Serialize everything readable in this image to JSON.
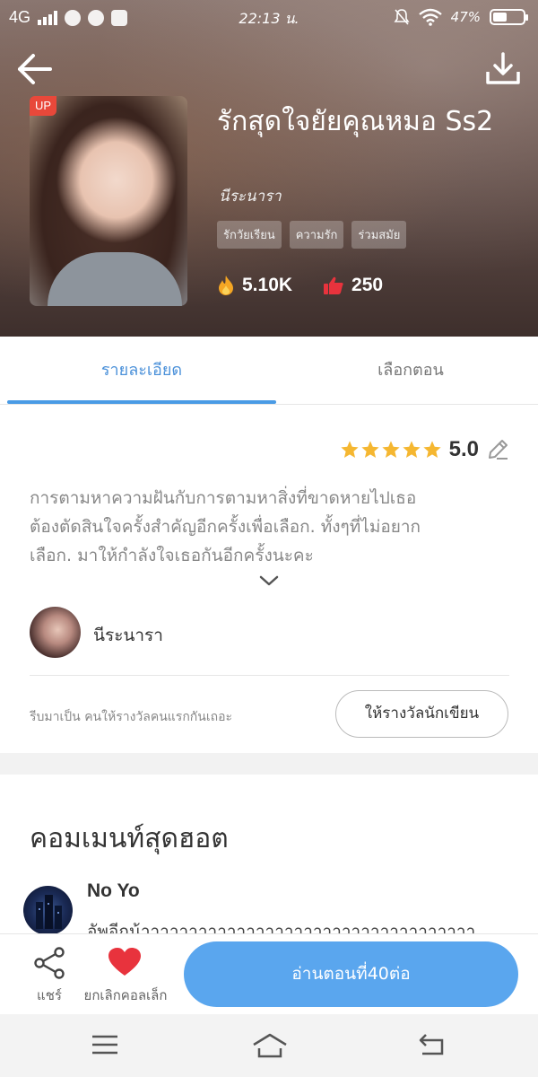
{
  "status_bar": {
    "network": "4G",
    "time": "22:13 น.",
    "battery": "47%",
    "battery_level": 0.47
  },
  "book": {
    "cover_badge": "UP",
    "title": "รักสุดใจยัยคุณหมอ Ss2",
    "author": "นีระนารา",
    "tags": [
      "รักวัยเรียน",
      "ความรัก",
      "ร่วมสมัย"
    ],
    "views": "5.10K",
    "likes": "250"
  },
  "tabs": {
    "detail": "รายละเอียด",
    "chapters": "เลือกตอน"
  },
  "details": {
    "rating": "5.0",
    "stars": 5,
    "synopsis_lines": [
      "การตามหาความฝันกับการตามหาสิ่งที่ขาดหายไปเธอ",
      "ต้องตัดสินใจครั้งสำคัญอีกครั้งเพื่อเลือก. ทั้งๆที่ไม่อยาก",
      "เลือก. มาให้กำลังใจเธอกันอีกครั้งนะคะ"
    ],
    "writer_name": "นีระนารา",
    "reward_prompt": "รีบมาเป็น คนให้รางวัลคนแรกกันเถอะ",
    "reward_button": "ให้รางวัลนักเขียน"
  },
  "comments": {
    "title": "คอมเมนท์สุดฮอต",
    "items": [
      {
        "user": "No Yo",
        "text": "อัพอีกน้าาาาาาาาาาาาาาาาาาาาาาาาาาาาาาาาาาา"
      }
    ]
  },
  "actions": {
    "share_label": "แชร์",
    "favorite_label": "ยกเลิกคอลเล็ก",
    "read_button": "อ่านตอนที่40ต่อ"
  },
  "colors": {
    "accent": "#4a90d9",
    "read_button": "#5aa6ee",
    "heart": "#e8333d",
    "star": "#f5b731"
  }
}
